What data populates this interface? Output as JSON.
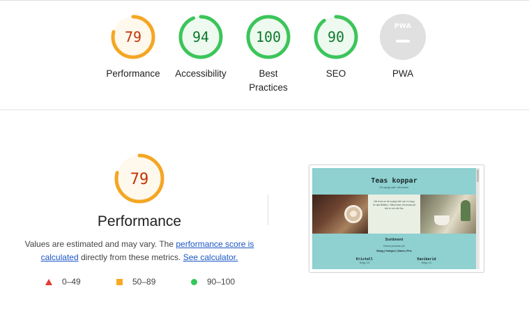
{
  "summary_gauges": [
    {
      "score": "79",
      "label": "Performance",
      "color": "#f4a623",
      "fraction": 0.79,
      "fill": "#fff8ed",
      "text_color": "#c33300"
    },
    {
      "score": "94",
      "label": "Accessibility",
      "color": "#3cc55a",
      "fraction": 0.94,
      "fill": "#eef9f0",
      "text_color": "#0b7a2a"
    },
    {
      "score": "100",
      "label": "Best Practices",
      "color": "#3cc55a",
      "fraction": 1.0,
      "fill": "#eef9f0",
      "text_color": "#0b7a2a"
    },
    {
      "score": "90",
      "label": "SEO",
      "color": "#3cc55a",
      "fraction": 0.9,
      "fill": "#eef9f0",
      "text_color": "#0b7a2a"
    }
  ],
  "pwa": {
    "badge_text": "PWA",
    "label": "PWA"
  },
  "performance": {
    "score": "79",
    "fraction": 0.79,
    "title": "Performance",
    "desc_prefix": "Values are estimated and may vary. The ",
    "link_score": "performance score is calculated",
    "desc_middle": " directly from these metrics. ",
    "link_calculator": "See calculator."
  },
  "legend": [
    {
      "range": "0–49",
      "shape": "triangle",
      "color": "#e53935"
    },
    {
      "range": "50–89",
      "shape": "square",
      "color": "#f9a825"
    },
    {
      "range": "90–100",
      "shape": "circle",
      "color": "#34c759"
    }
  ],
  "screenshot": {
    "site_title": "Teas koppar",
    "subtitle": "Ett mysigt café i ditt kvarter",
    "intro": "Här finns du ett mysigt café och en kopp för alla tillfällen. Välkommen att smaka på vårt te och vår fika.",
    "section": "Sortiment",
    "section_small": "Sortera produkter på:",
    "nav": "Betyg | Kategori | Namn | Pris",
    "products": [
      {
        "name": "Kristall",
        "price": "Betyg: 3.5"
      },
      {
        "name": "Kaviberid",
        "price": "Betyg: 4.0"
      }
    ]
  }
}
